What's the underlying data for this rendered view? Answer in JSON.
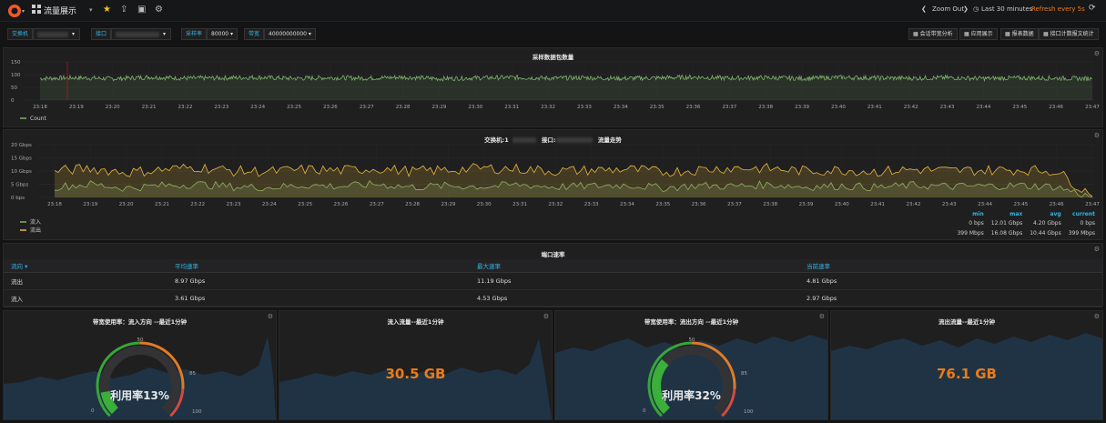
{
  "topbar": {
    "dashboard_title": "流量展示",
    "zoom_out": "Zoom Out",
    "time_range": "Last 30 minutes",
    "refresh": "Refresh every 5s"
  },
  "variables": {
    "switch_label": "交换机",
    "port_label": "接口",
    "sample_label": "采样率",
    "sample_value": "80000",
    "bandwidth_label": "带宽",
    "bandwidth_value": "40000000000"
  },
  "dashboard_links": [
    "会话带宽分析",
    "应用展示",
    "报表数据",
    "接口计数报文统计"
  ],
  "panels": {
    "sample_chart": {
      "title": "采样数据包数量",
      "legend": "Count"
    },
    "traffic_chart": {
      "title_prefix": "交换机:1",
      "title_mid": "接口:",
      "title_suffix": "流量走势",
      "legend_in": "流入",
      "legend_out": "流出",
      "stats_headers": [
        "min",
        "max",
        "avg",
        "current"
      ],
      "stats_in": [
        "0 bps",
        "12.01 Gbps",
        "4.20 Gbps",
        "0 bps"
      ],
      "stats_out": [
        "399 Mbps",
        "16.08 Gbps",
        "10.44 Gbps",
        "399 Mbps"
      ]
    },
    "port_rate_table": {
      "title": "端口速率",
      "headers": [
        "流向 ▾",
        "平均速率",
        "最大速率",
        "当前速率"
      ],
      "rows": [
        [
          "流出",
          "8.97 Gbps",
          "11.19 Gbps",
          "4.81 Gbps"
        ],
        [
          "流入",
          "3.61 Gbps",
          "4.53 Gbps",
          "2.97 Gbps"
        ]
      ]
    },
    "gauge_in": {
      "title": "带宽使用率：流入方向 --最近1分钟",
      "value_text": "利用率13%",
      "value": 13,
      "tick_0": "0",
      "tick_50": "50",
      "tick_85": "85",
      "tick_100": "100"
    },
    "stat_in": {
      "title": "流入流量--最近1分钟",
      "value": "30.5 GB"
    },
    "gauge_out": {
      "title": "带宽使用率：流出方向 --最近1分钟",
      "value_text": "利用率32%",
      "value": 32,
      "tick_0": "0",
      "tick_50": "50",
      "tick_85": "85",
      "tick_100": "100"
    },
    "stat_out": {
      "title": "流出流量--最近1分钟",
      "value": "76.1 GB"
    }
  },
  "chart_data": [
    {
      "type": "line",
      "title": "采样数据包数量",
      "x": [
        "23:18",
        "23:19",
        "23:20",
        "23:21",
        "23:22",
        "23:23",
        "23:24",
        "23:25",
        "23:26",
        "23:27",
        "23:28",
        "23:29",
        "23:30",
        "23:31",
        "23:32",
        "23:33",
        "23:34",
        "23:35",
        "23:36",
        "23:37",
        "23:38",
        "23:39",
        "23:40",
        "23:41",
        "23:42",
        "23:43",
        "23:44",
        "23:45",
        "23:46",
        "23:47"
      ],
      "yticks": [
        "150",
        "100",
        "50",
        "0"
      ],
      "ylim": [
        0,
        150
      ],
      "series": [
        {
          "name": "Count",
          "values": [
            85,
            88,
            84,
            90,
            86,
            87,
            89,
            85,
            88,
            86,
            90,
            84,
            87,
            89,
            86,
            88,
            85,
            87,
            90,
            86,
            88,
            85,
            89,
            87,
            86,
            88,
            85,
            87,
            86,
            84
          ]
        }
      ],
      "grid": true,
      "legend": "bottom-left"
    },
    {
      "type": "area",
      "title": "交换机:1 接口: 流量走势",
      "x": [
        "23:18",
        "23:19",
        "23:20",
        "23:21",
        "23:22",
        "23:23",
        "23:24",
        "23:25",
        "23:26",
        "23:27",
        "23:28",
        "23:29",
        "23:30",
        "23:31",
        "23:32",
        "23:33",
        "23:34",
        "23:35",
        "23:36",
        "23:37",
        "23:38",
        "23:39",
        "23:40",
        "23:41",
        "23:42",
        "23:43",
        "23:44",
        "23:45",
        "23:46",
        "23:47"
      ],
      "yticks": [
        "20 Gbps",
        "15 Gbps",
        "10 Gbps",
        "5 Gbps",
        "0 bps"
      ],
      "ylim": [
        0,
        20
      ],
      "series": [
        {
          "name": "流入",
          "values": [
            4,
            5,
            3.5,
            4.5,
            5,
            4,
            3.8,
            4.6,
            4.2,
            5,
            3.9,
            4.4,
            4.1,
            4.8,
            4,
            4.3,
            4.7,
            3.6,
            4.5,
            4.2,
            4.9,
            4,
            4.4,
            3.8,
            4.6,
            4.1,
            4.3,
            4.5,
            4,
            0
          ]
        },
        {
          "name": "流出",
          "values": [
            10,
            11,
            9.5,
            10.5,
            11.5,
            10,
            9.8,
            10.6,
            10.2,
            11,
            9.9,
            10.4,
            11.1,
            10.8,
            10,
            10.3,
            10.7,
            9.6,
            10.5,
            11.2,
            10.9,
            10,
            10.4,
            9.8,
            10.6,
            10.1,
            10.3,
            10.5,
            10,
            0.4
          ]
        }
      ],
      "grid": true,
      "legend": "bottom-left"
    }
  ]
}
